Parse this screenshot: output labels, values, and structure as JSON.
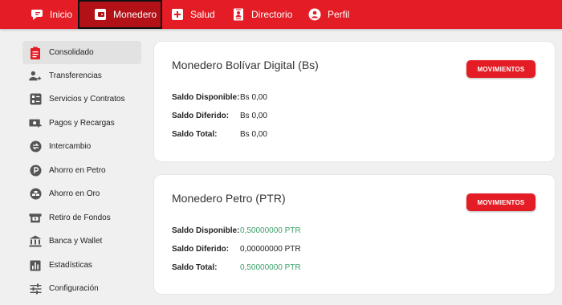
{
  "nav": {
    "inicio": "Inicio",
    "monedero": "Monedero",
    "salud": "Salud",
    "directorio": "Directorio",
    "perfil": "Perfil"
  },
  "sidebar": {
    "items": [
      {
        "label": "Consolidado",
        "icon": "clipboard-icon"
      },
      {
        "label": "Transferencias",
        "icon": "user-transfer-icon"
      },
      {
        "label": "Servicios y Contratos",
        "icon": "services-icon"
      },
      {
        "label": "Pagos y Recargas",
        "icon": "payments-icon"
      },
      {
        "label": "Intercambio",
        "icon": "exchange-icon"
      },
      {
        "label": "Ahorro en Petro",
        "icon": "petro-icon"
      },
      {
        "label": "Ahorro en Oro",
        "icon": "gold-icon"
      },
      {
        "label": "Retiro de Fondos",
        "icon": "withdraw-icon"
      },
      {
        "label": "Banca y Wallet",
        "icon": "bank-icon"
      },
      {
        "label": "Estadísticas",
        "icon": "stats-icon"
      },
      {
        "label": "Configuración",
        "icon": "settings-icon"
      }
    ]
  },
  "cards": {
    "bs": {
      "title": "Monedero Bolívar Digital (Bs)",
      "button": "MOVIMIENTOS",
      "disponible_label": "Saldo Disponible:",
      "disponible": "Bs 0,00",
      "diferido_label": "Saldo Diferido:",
      "diferido": "Bs 0,00",
      "total_label": "Saldo Total:",
      "total": "Bs 0,00"
    },
    "ptr": {
      "title": "Monedero Petro (PTR)",
      "button": "MOVIMIENTOS",
      "disponible_label": "Saldo Disponible:",
      "disponible": "0,50000000 PTR",
      "diferido_label": "Saldo Diferido:",
      "diferido": "0,00000000 PTR",
      "total_label": "Saldo Total:",
      "total": "0,50000000 PTR"
    }
  },
  "colors": {
    "brand": "#e31c25",
    "active_nav": "#b21117",
    "positive": "#3ea06a"
  }
}
